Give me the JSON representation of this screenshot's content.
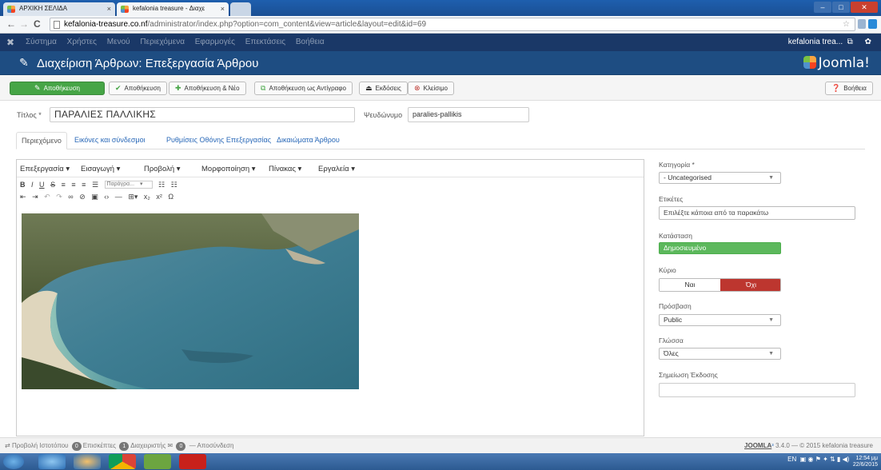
{
  "browser": {
    "tabs": [
      {
        "label": "ΑΡΧΙΚΗ ΣΕΛΙΔΑ"
      },
      {
        "label": "kefalonia treasure - Διαχε"
      }
    ],
    "url_host": "kefalonia-treasure.co.nf",
    "url_path": "/administrator/index.php?option=com_content&view=article&layout=edit&id=69"
  },
  "admin_menu": {
    "items": [
      "Σύστημα",
      "Χρήστες",
      "Μενού",
      "Περιεχόμενα",
      "Εφαρμογές",
      "Επεκτάσεις",
      "Βοήθεια"
    ],
    "site_name": "kefalonia trea..."
  },
  "header": {
    "title": "Διαχείριση Άρθρων: Επεξεργασία Άρθρου",
    "brand": "Joomla!"
  },
  "toolbar": {
    "apply": "Αποθήκευση",
    "save": "Αποθήκευση",
    "save_new": "Αποθήκευση & Νέο",
    "save_copy": "Αποθήκευση ως Αντίγραφο",
    "versions": "Εκδόσεις",
    "close": "Κλείσιμο",
    "help": "Βοήθεια"
  },
  "form": {
    "title_label": "Τίτλος *",
    "title_value": "ΠΑΡΑΛΙΕΣ ΠΑΛΛΙΚΗΣ",
    "alias_label": "Ψευδώνυμο",
    "alias_value": "paralies-pallikis"
  },
  "tabs": [
    {
      "label": "Περιεχόμενο"
    },
    {
      "label": "Εικόνες και σύνδεσμοι"
    },
    {
      "label": "Ρυθμίσεις Οθόνης Επεξεργασίας"
    },
    {
      "label": "Δικαιώματα Άρθρου"
    }
  ],
  "editor": {
    "menus": [
      "Επεξεργασία ▾",
      "Εισαγωγή ▾",
      "Προβολή ▾",
      "Μορφοποίηση ▾",
      "Πίνακας ▾",
      "Εργαλεία ▾"
    ],
    "format_select": "Παράγρα..."
  },
  "sidebar": {
    "category_label": "Κατηγορία *",
    "category_value": "- Uncategorised",
    "tags_label": "Ετικέτες",
    "tags_placeholder": "Επιλέξτε κάποια από τα παρακάτω",
    "status_label": "Κατάσταση",
    "status_value": "Δημοσιευμένο",
    "featured_label": "Κύριο",
    "featured_yes": "Ναι",
    "featured_no": "Όχι",
    "access_label": "Πρόσβαση",
    "access_value": "Public",
    "language_label": "Γλώσσα",
    "language_value": "Όλες",
    "version_note_label": "Σημείωση Έκδοσης"
  },
  "statusbar": {
    "view_site": "Προβολή Ιστοτόπου",
    "visitors_count": "0",
    "visitors_label": "Επισκέπτες",
    "admins_count": "1",
    "admins_label": "Διαχειριστής",
    "messages_count": "0",
    "logout": "Αποσύνδεση",
    "joomla_label": "JOOMLA",
    "version_text": "3.4.0 — © 2015 kefalonia treasure"
  },
  "taskbar": {
    "lang": "EN",
    "time": "12:54 μμ",
    "date": "22/6/2015"
  },
  "colors": {
    "header_blue": "#1e4d82",
    "menubar_navy": "#1a3867",
    "success_green": "#46a546",
    "danger_red": "#bd362f",
    "link_blue": "#2a69b8"
  }
}
